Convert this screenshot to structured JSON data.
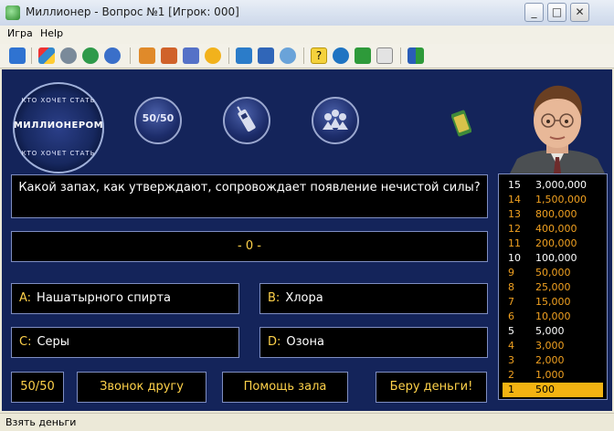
{
  "window": {
    "title": "Миллионер - Вопрос №1 [Игрок: 000]"
  },
  "menu": {
    "items": [
      "Игра",
      "Help"
    ]
  },
  "toolbar": {
    "icons": [
      "refresh-icon",
      "trophy-icon",
      "magnifier-icon",
      "globe-icon",
      "stopwatch-icon",
      "user-icon",
      "users-icon",
      "checklist-icon",
      "hand-icon",
      "grid-icon",
      "windows-icon",
      "search-icon",
      "help-icon",
      "info-icon",
      "home-icon",
      "mail-icon",
      "exit-icon"
    ]
  },
  "logo": {
    "top": "КТО ХОЧЕТ СТАТЬ",
    "main": "МИЛЛИОНЕРОМ",
    "bottom": "КТО ХОЧЕТ СТАТЬ"
  },
  "lifelines": {
    "fifty": "50/50",
    "phone_icon": "phone-icon",
    "audience_icon": "audience-icon"
  },
  "question": {
    "text": "Какой запах, как утверждают, сопровождает появление нечистой силы?"
  },
  "timer": {
    "text": "- 0 -"
  },
  "answers": [
    {
      "letter": "A:",
      "text": "Нашатырного спирта"
    },
    {
      "letter": "B:",
      "text": "Хлора"
    },
    {
      "letter": "C:",
      "text": "Серы"
    },
    {
      "letter": "D:",
      "text": "Озона"
    }
  ],
  "buttons": {
    "fifty": "50/50",
    "phone": "Звонок другу",
    "audience": "Помощь зала",
    "take_money": "Беру деньги!"
  },
  "ladder": [
    {
      "num": "15",
      "amount": "3,000,000",
      "style": "white"
    },
    {
      "num": "14",
      "amount": "1,500,000",
      "style": "orange"
    },
    {
      "num": "13",
      "amount": "800,000",
      "style": "orange"
    },
    {
      "num": "12",
      "amount": "400,000",
      "style": "orange"
    },
    {
      "num": "11",
      "amount": "200,000",
      "style": "orange"
    },
    {
      "num": "10",
      "amount": "100,000",
      "style": "white"
    },
    {
      "num": "9",
      "amount": "50,000",
      "style": "orange"
    },
    {
      "num": "8",
      "amount": "25,000",
      "style": "orange"
    },
    {
      "num": "7",
      "amount": "15,000",
      "style": "orange"
    },
    {
      "num": "6",
      "amount": "10,000",
      "style": "orange"
    },
    {
      "num": "5",
      "amount": "5,000",
      "style": "white"
    },
    {
      "num": "4",
      "amount": "3,000",
      "style": "orange"
    },
    {
      "num": "3",
      "amount": "2,000",
      "style": "orange"
    },
    {
      "num": "2",
      "amount": "1,000",
      "style": "orange"
    },
    {
      "num": "1",
      "amount": "500",
      "style": "active"
    }
  ],
  "status": {
    "text": "Взять деньги"
  },
  "colors": {
    "game_bg": "#14245a",
    "panel_border": "#7f8ec2",
    "accent_gold": "#ffd24a",
    "ladder_orange": "#f0a020"
  }
}
